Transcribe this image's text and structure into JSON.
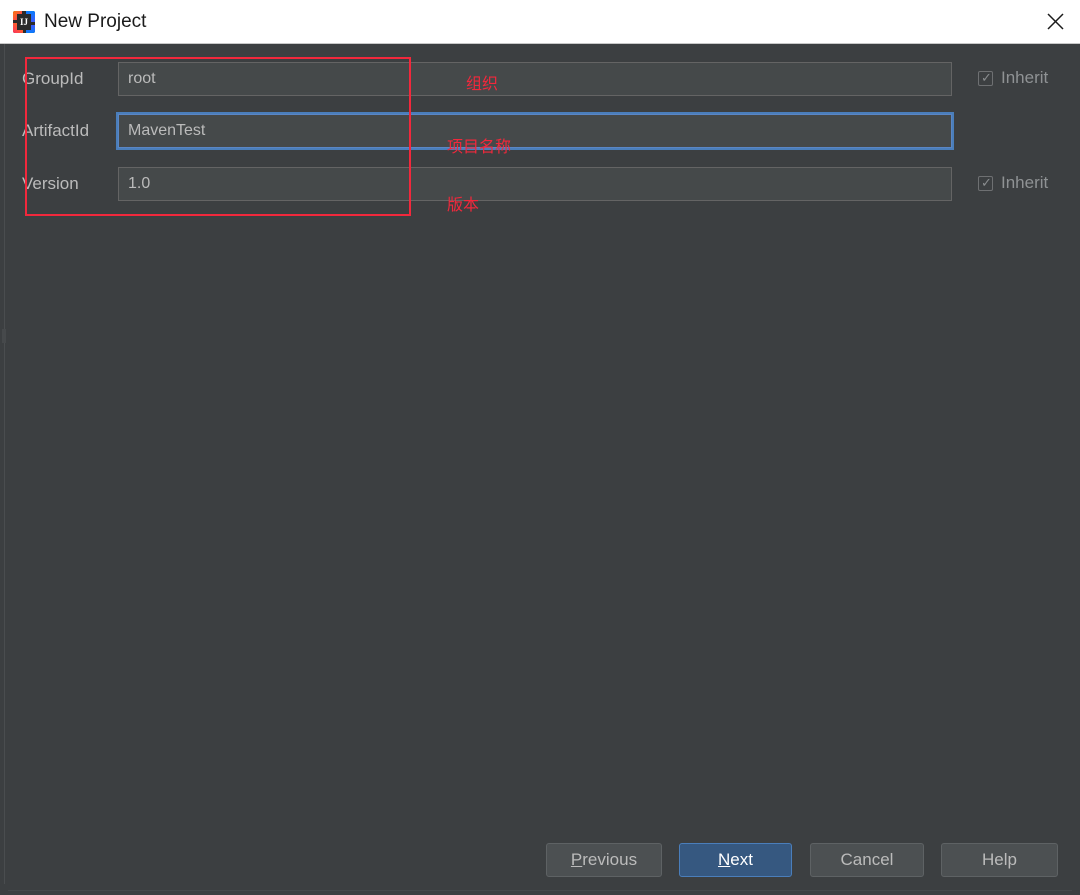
{
  "window": {
    "title": "New Project",
    "icon": "intellij-idea-icon",
    "icon_glyph": "IJ",
    "close_icon": "close-icon"
  },
  "form": {
    "rows": [
      {
        "label": "GroupId",
        "value": "root",
        "placeholder": "",
        "focused": false,
        "inherit": {
          "label": "Inherit",
          "checked": true,
          "glyph": "✓"
        },
        "annotation": "组织"
      },
      {
        "label": "ArtifactId",
        "value": "MavenTest",
        "placeholder": "",
        "focused": true,
        "inherit": null,
        "annotation": "项目名称"
      },
      {
        "label": "Version",
        "value": "1.0",
        "placeholder": "",
        "focused": false,
        "inherit": {
          "label": "Inherit",
          "checked": true,
          "glyph": "✓"
        },
        "annotation": "版本"
      }
    ]
  },
  "annotations": {
    "highlight_color": "#f2283c",
    "rect_name": "maven-coordinates-highlight"
  },
  "footer": {
    "buttons": [
      {
        "name": "previous-button",
        "label": "Previous",
        "mnemonic": "P",
        "primary": false
      },
      {
        "name": "next-button",
        "label": "Next",
        "mnemonic": "N",
        "primary": true
      },
      {
        "name": "cancel-button",
        "label": "Cancel",
        "mnemonic": "",
        "primary": false
      },
      {
        "name": "help-button",
        "label": "Help",
        "mnemonic": "",
        "primary": false
      }
    ]
  },
  "colors": {
    "background": "#3c3f41",
    "input_background": "#45494a",
    "accent_blue": "#365880",
    "focus_blue": "#4a7ebb",
    "text": "#bbbbbb",
    "titlebar": "#ffffff"
  }
}
